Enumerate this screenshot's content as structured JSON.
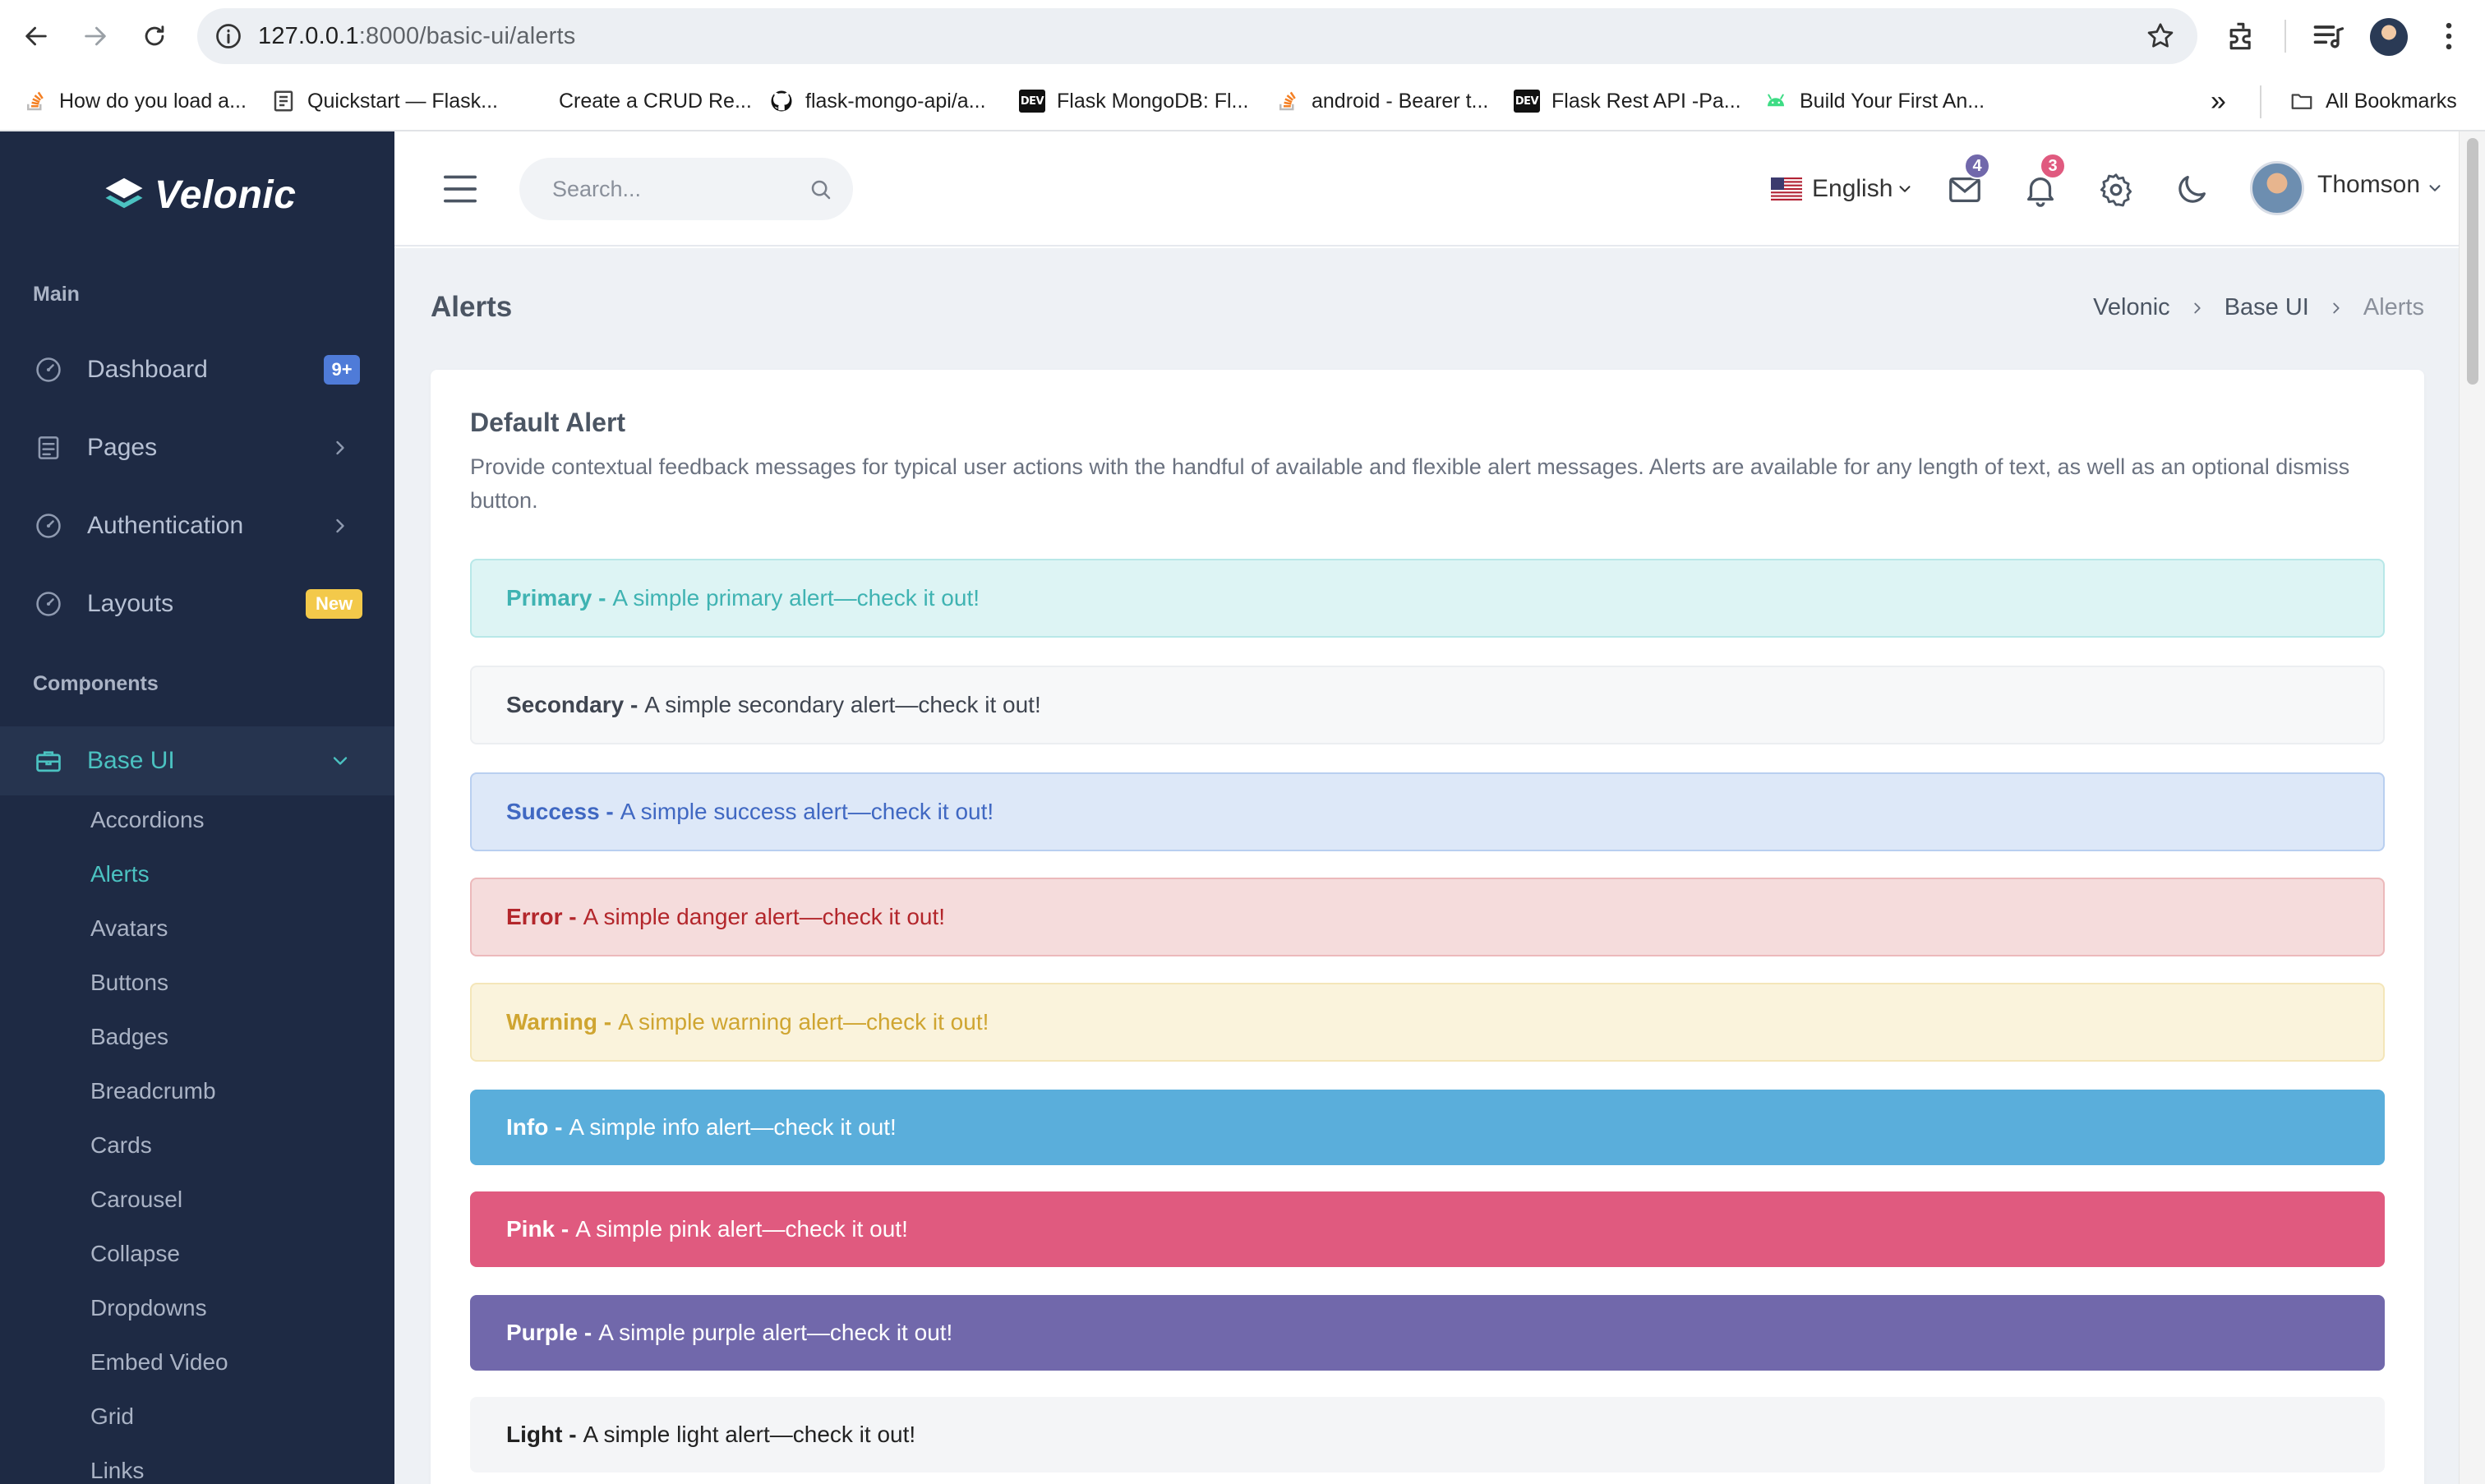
{
  "browser": {
    "url_host": "127.0.0.1",
    "url_path": ":8000/basic-ui/alerts",
    "bookmarks": [
      "How do you load a...",
      "Quickstart — Flask...",
      "Create a CRUD Re...",
      "flask-mongo-api/a...",
      "Flask MongoDB: Fl...",
      "android - Bearer t...",
      "Flask Rest API -Pa...",
      "Build Your First An..."
    ],
    "overflow": "»",
    "all_bookmarks": "All Bookmarks"
  },
  "sidebar": {
    "logo": "Velonic",
    "section_main": "Main",
    "section_components": "Components",
    "items": [
      {
        "label": "Dashboard",
        "badge": "9+"
      },
      {
        "label": "Pages"
      },
      {
        "label": "Authentication"
      },
      {
        "label": "Layouts",
        "badge": "New"
      },
      {
        "label": "Base UI"
      }
    ],
    "submenu": [
      "Accordions",
      "Alerts",
      "Avatars",
      "Buttons",
      "Badges",
      "Breadcrumb",
      "Cards",
      "Carousel",
      "Collapse",
      "Dropdowns",
      "Embed Video",
      "Grid",
      "Links"
    ]
  },
  "topbar": {
    "search_placeholder": "Search...",
    "language": "English",
    "mail_count": "4",
    "notification_count": "3",
    "user_name": "Thomson"
  },
  "page": {
    "title": "Alerts",
    "breadcrumb": [
      "Velonic",
      "Base UI",
      "Alerts"
    ]
  },
  "card": {
    "title": "Default Alert",
    "description": "Provide contextual feedback messages for typical user actions with the handful of available and flexible alert messages. Alerts are available for any length of text, as well as an optional dismiss button."
  },
  "alerts": [
    {
      "strong": "Primary -",
      "text": "A simple primary alert—check it out!"
    },
    {
      "strong": "Secondary -",
      "text": "A simple secondary alert—check it out!"
    },
    {
      "strong": "Success -",
      "text": "A simple success alert—check it out!"
    },
    {
      "strong": "Error -",
      "text": "A simple danger alert—check it out!"
    },
    {
      "strong": "Warning -",
      "text": "A simple warning alert—check it out!"
    },
    {
      "strong": "Info -",
      "text": "A simple info alert—check it out!"
    },
    {
      "strong": "Pink -",
      "text": "A simple pink alert—check it out!"
    },
    {
      "strong": "Purple -",
      "text": "A simple purple alert—check it out!"
    },
    {
      "strong": "Light -",
      "text": "A simple light alert—check it out!"
    }
  ],
  "colors": {
    "sidebar_bg": "#1e2a44",
    "accent": "#4bc2c1",
    "info": "#5aaedb",
    "pink": "#e05a7f",
    "purple": "#7168ab"
  }
}
